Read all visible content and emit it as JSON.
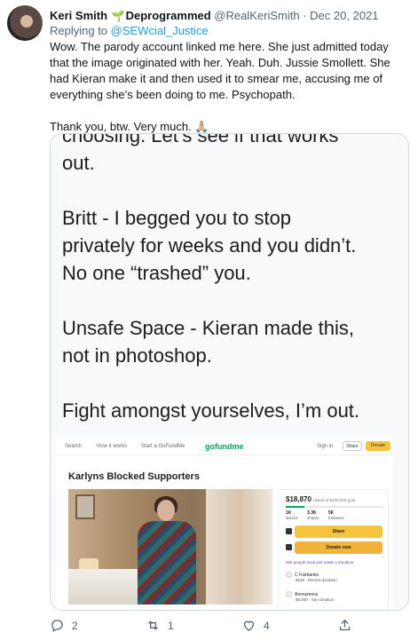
{
  "tweet": {
    "author_name": "Keri Smith",
    "badge": "🌱",
    "author_label": "Deprogrammed",
    "handle": "@RealKeriSmith",
    "separator": "·",
    "date": "Dec 20, 2021",
    "reply_prefix": "Replying to ",
    "reply_handle": "@SEWcial_Justice",
    "text_p1": "Wow. The parody account linked me here. She just admitted today that the image originated with her. Yeah. Duh. Jussie Smollett. She had Kieran make it and then used it to smear me, accusing me of everything she’s been doing to me. Psychopath.",
    "text_p2": "Thank you, btw. Very much. 🙏🏼"
  },
  "screenshot": {
    "clipped_line": "choosing. Let’s see if that works",
    "lines": [
      "out.",
      "",
      "Britt - I begged you to stop",
      "privately for weeks and you didn’t.",
      "No one “trashed” you.",
      "",
      "Unsafe Space - Kieran made this,",
      "not in photoshop.",
      "",
      "Fight amongst yourselves, I’m out."
    ]
  },
  "gofundme": {
    "nav_search": "Search",
    "nav_how": "How it works",
    "nav_start": "Start a GoFundMe",
    "logo": "gofundme",
    "sign_in": "Sign in",
    "share": "Share",
    "donate": "Donate",
    "campaign_title": "Karlyns Blocked Supporters",
    "amount": "$18,870",
    "goal": "raised of $100,000 goal",
    "progress": 0.19,
    "stats": [
      {
        "value": "1K",
        "label": "donors"
      },
      {
        "value": "3.3K",
        "label": "shares"
      },
      {
        "value": "5K",
        "label": "followers"
      }
    ],
    "share_big": "Share",
    "donate_big": "Donate now",
    "trend": "865 people have just made a donation",
    "donor1_name": "C Fairbanks",
    "donor1_meta": "$100 · Recent donation",
    "donor2_name": "Anonymous",
    "donor2_meta": "$5,000 · Top donation"
  },
  "actions": {
    "reply_count": "2",
    "retweet_count": "1",
    "like_count": "4"
  }
}
